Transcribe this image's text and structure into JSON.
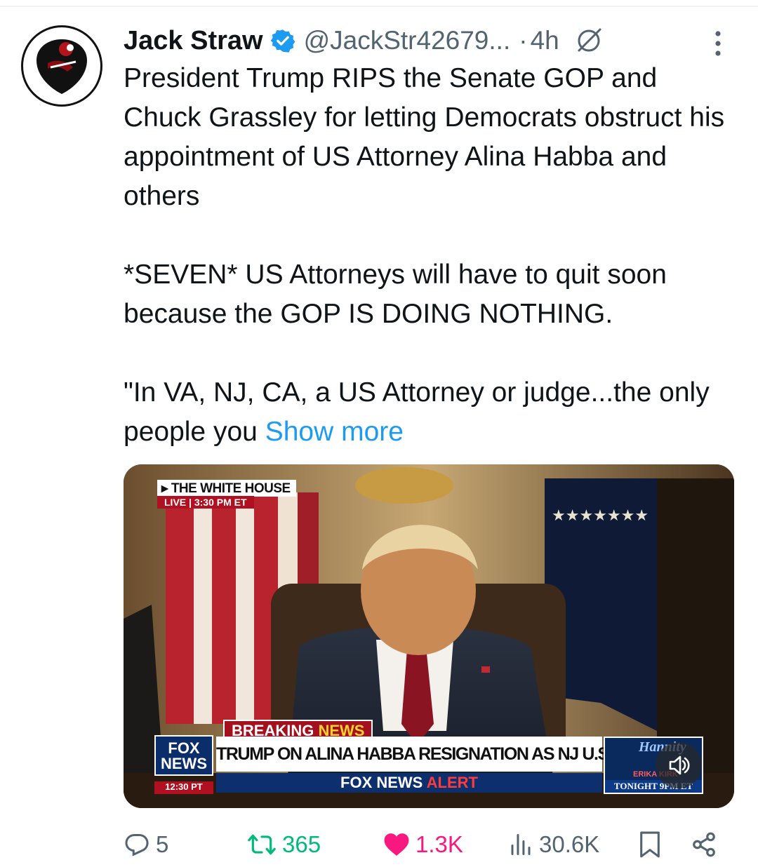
{
  "tweet": {
    "author_name": "Jack Straw",
    "handle": "@JackStr42679...",
    "separator": "·",
    "time": "4h",
    "paragraphs": [
      "President Trump RIPS the Senate GOP and Chuck Grassley for letting Democrats obstruct his appointment of US Attorney Alina Habba and others",
      "*SEVEN* US Attorneys will have to quit soon because the GOP IS DOING NOTHING.",
      "\"In VA, NJ, CA, a US Attorney or judge...the only people you"
    ],
    "show_more": "Show more"
  },
  "video": {
    "location_label": "THE WHITE HOUSE",
    "live_label": "LIVE",
    "live_divider": "|",
    "live_time": "3:30 PM ET",
    "breaking_word": "BREAKING",
    "news_word": "NEWS",
    "fox_logo_top": "FOX",
    "fox_logo_bottom": "NEWS",
    "fox_time": "12:30 PT",
    "headline": "TRUMP ON ALINA HABBA RESIGNATION AS NJ U.S. ATTY",
    "alert_brand": "FOX NEWS",
    "alert_word": "ALERT",
    "promo_show": "Hannity",
    "promo_guest": "ERIKA KIRK",
    "promo_time": "TONIGHT 9PM ET"
  },
  "actions": {
    "replies": "5",
    "reposts": "365",
    "likes": "1.3K",
    "views": "30.6K"
  },
  "icons": {
    "verified": "verified-badge-icon",
    "grok": "grok-icon",
    "more": "more-options-icon",
    "reply": "reply-icon",
    "repost": "repost-icon",
    "like": "heart-icon",
    "views": "views-icon",
    "bookmark": "bookmark-icon",
    "share": "share-icon",
    "mute": "speaker-icon"
  },
  "colors": {
    "link": "#1d9bf0",
    "secondary_text": "#536471",
    "repost": "#00ba7c",
    "like": "#f91880"
  }
}
